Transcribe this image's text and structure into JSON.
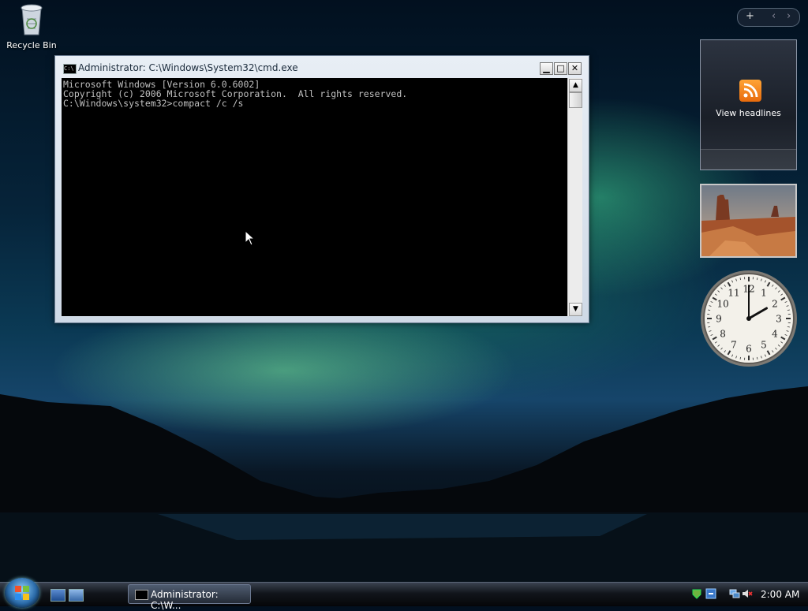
{
  "desktop": {
    "recycle_bin_label": "Recycle Bin"
  },
  "cmd_window": {
    "title": "Administrator: C:\\Windows\\System32\\cmd.exe",
    "icon_text": "C:\\",
    "minimize": "▁",
    "maximize": "□",
    "close": "✕",
    "console_lines": [
      "Microsoft Windows [Version 6.0.6002]",
      "Copyright (c) 2006 Microsoft Corporation.  All rights reserved.",
      "",
      "C:\\Windows\\system32>compact /c /s"
    ]
  },
  "sidebar": {
    "add_gadget": "+",
    "prev": "‹",
    "next": "›",
    "feed_label": "View headlines"
  },
  "clock": {
    "numerals": [
      "12",
      "1",
      "2",
      "3",
      "4",
      "5",
      "6",
      "7",
      "8",
      "9",
      "10",
      "11"
    ],
    "time": "2:00"
  },
  "taskbar": {
    "task_label": "Administrator: C:\\W...",
    "time": "2:00 AM"
  },
  "colors": {
    "console_bg": "#000000",
    "console_text": "#c0c0c0",
    "rss_orange": "#f28a1e"
  }
}
